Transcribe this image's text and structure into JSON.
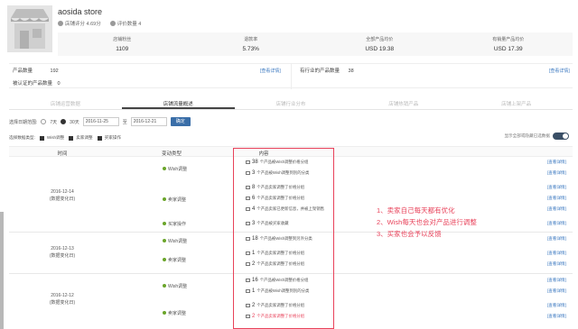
{
  "store": {
    "name": "aosida store",
    "rating": "店铺评分 4.69分",
    "review_count": "评价数量 4",
    "stats": [
      {
        "label": "店铺粉丝",
        "value": "1109"
      },
      {
        "label": "退款率",
        "value": "5.73%"
      },
      {
        "label": "全部产品均价",
        "value": "USD 19.38"
      },
      {
        "label": "有销量产品均价",
        "value": "USD 17.39"
      }
    ]
  },
  "products": {
    "count_label": "产品数量",
    "count_value": "192",
    "count_link": "[查看详情]",
    "sales_label": "有行业的产品数量",
    "sales_value": "38",
    "sales_link": "[查看详情]",
    "sold_label": "被认证的产品数量",
    "sold_value": "0"
  },
  "tabs": [
    "店铺运营数据",
    "店铺流量概述",
    "店铺行业分布",
    "店铺热销产品",
    "店铺上架产品"
  ],
  "filter": {
    "label": "选择日期范围:",
    "opt1": "7天",
    "opt2": "30天",
    "start": "2016-11-25",
    "end": "2016-12-21",
    "sep": "至",
    "button": "确定"
  },
  "types": {
    "label": "选择数据类型:",
    "t1": "Wish调整",
    "t2": "卖家调整",
    "t3": "买家操作",
    "toggle_label": "显示全部或隐藏已选数据"
  },
  "table": {
    "headers": [
      "时间",
      "变动类型",
      "内容"
    ],
    "groups": [
      {
        "date": "2016-12-14",
        "note": "(数据变化日)",
        "subs": [
          "Wish调整",
          "卖家调整",
          "买家操作"
        ],
        "items": [
          {
            "num": "38",
            "text": "个产品被Wish调整价格分组"
          },
          {
            "num": "3",
            "text": "个产品被Wish调整到别的分类"
          },
          {
            "num": "8",
            "text": "个产品卖家调整了价格分组"
          },
          {
            "num": "6",
            "text": "个产品卖家调整了价格分组"
          },
          {
            "num": "4",
            "text": "个产品卖家已更新信息，并被上架销售"
          },
          {
            "num": "3",
            "text": "个产品被买家收藏"
          }
        ]
      },
      {
        "date": "2016-12-13",
        "note": "(数据变化日)",
        "subs": [
          "Wish调整",
          "卖家调整"
        ],
        "items": [
          {
            "num": "18",
            "text": "个产品被Wish调整到另外分类"
          },
          {
            "num": "1",
            "text": "个产品卖家调整了价格分组"
          },
          {
            "num": "2",
            "text": "个产品卖家调整了价格分组"
          }
        ]
      },
      {
        "date": "2016-12-12",
        "note": "(数据变化日)",
        "subs": [
          "Wish调整",
          "卖家调整"
        ],
        "items": [
          {
            "num": "16",
            "text": "个产品被Wish调整价格分组"
          },
          {
            "num": "1",
            "text": "个产品被Wish调整到别的分类"
          },
          {
            "num": "2",
            "text": "个产品卖家调整了价格分组"
          },
          {
            "num": "2",
            "text": "个产品卖家调整了价格分组"
          }
        ]
      }
    ],
    "detail_link": "[查看详情]"
  },
  "notes": [
    "1、卖家自己每天都有优化",
    "2、Wish每天也会对产品进行调整",
    "3、买家也会予以反馈"
  ],
  "colors": {
    "accent": "#e8425a",
    "link": "#3a78c0",
    "button": "#3a6ea8"
  }
}
